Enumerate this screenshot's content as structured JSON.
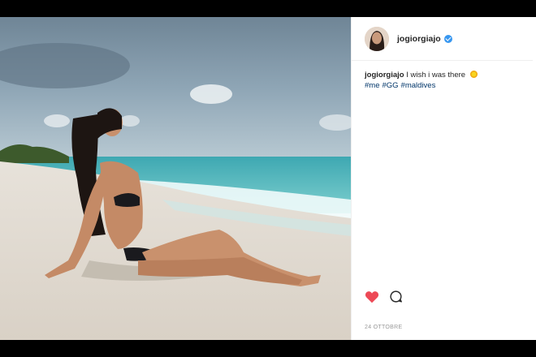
{
  "post": {
    "username": "jogiorgiajo",
    "caption_text": "I wish i was there",
    "hashtags": [
      "#me",
      "#GG",
      "#maldives"
    ],
    "date": "24 OTTOBRE"
  },
  "icons": {
    "verified": "verified-badge-icon",
    "caption_emoji": "sun-emoji-icon",
    "like": "heart-icon",
    "comment": "comment-bubble-icon"
  },
  "colors": {
    "like": "#ed4956",
    "verified": "#3897f0",
    "hashtag": "#003569"
  }
}
